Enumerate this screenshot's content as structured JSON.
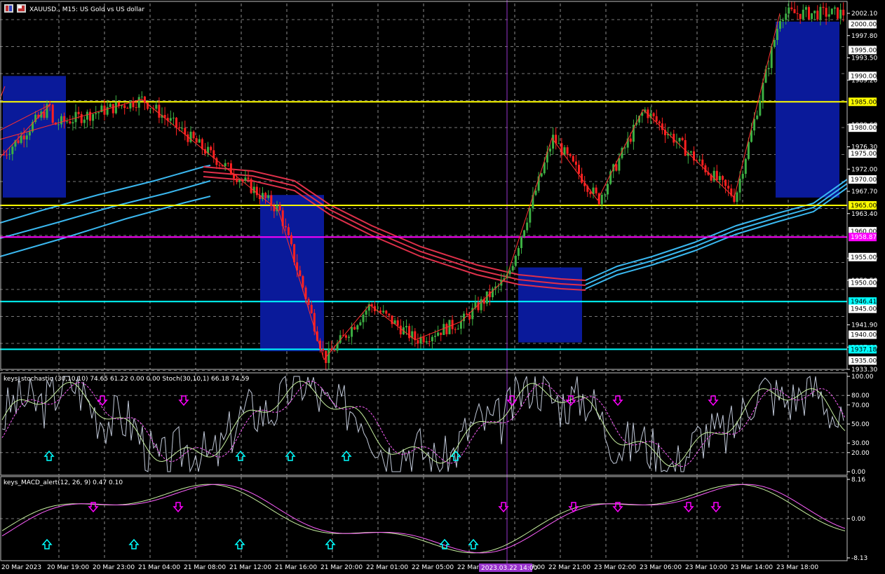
{
  "window": {
    "title": "XAUUSD., M15:  US Gold vs US dollar"
  },
  "colors": {
    "background": "#000000",
    "grid": "#c8c8c8",
    "bull": "#3cb043",
    "bear": "#ff2020",
    "zone": "#0a1a9a",
    "ema_red": "#e0304a",
    "ema_blue": "#3ab8f0",
    "level_yellow": "#ffff00",
    "level_magenta": "#ff00ff",
    "level_cyan": "#00ffff",
    "stoch_main": "#c8f0a0",
    "stoch_signal": "#ff60ff",
    "stoch_raw": "#c0c8d8",
    "vline": "#9933cc"
  },
  "indicators": {
    "stoch_header": "keys_stochastic (30,10,10) 74.65 61.22 0.00 0.00 Stoch(30,10,1) 66.18 74.59",
    "macd_header": "keys_MACD_alert(12, 26, 9) 0.47 0.10"
  },
  "price_axis": {
    "ticks": [
      "2002.10",
      "1997.80",
      "1993.50",
      "1989.20",
      "1980.60",
      "1976.30",
      "1972.00",
      "1967.70",
      "1963.40",
      "1954.80",
      "1950.50",
      "1941.90",
      "1937.60",
      "1933.30"
    ],
    "tags": [
      {
        "text": "2000.00",
        "style": "white"
      },
      {
        "text": "1995.00",
        "style": "white"
      },
      {
        "text": "1990.00",
        "style": "white"
      },
      {
        "text": "1985.00",
        "style": "yellow"
      },
      {
        "text": "1980.00",
        "style": "white"
      },
      {
        "text": "1975.00",
        "style": "white"
      },
      {
        "text": "1970.00",
        "style": "white"
      },
      {
        "text": "1965.00",
        "style": "yellow"
      },
      {
        "text": "1960.00",
        "style": "white"
      },
      {
        "text": "1958.87",
        "style": "magenta"
      },
      {
        "text": "1955.00",
        "style": "white"
      },
      {
        "text": "1950.00",
        "style": "white"
      },
      {
        "text": "1946.41",
        "style": "cyan"
      },
      {
        "text": "1945.00",
        "style": "white"
      },
      {
        "text": "1940.00",
        "style": "white"
      },
      {
        "text": "1937.18",
        "style": "cyan"
      },
      {
        "text": "1935.00",
        "style": "white"
      }
    ]
  },
  "stoch_axis": {
    "ticks": [
      "100.00",
      "80.00",
      "70.00",
      "50.00",
      "30.00",
      "20.00",
      "0.00"
    ]
  },
  "macd_axis": {
    "ticks": [
      "8.16",
      "0.00",
      "-8.13"
    ]
  },
  "time_axis": {
    "labels": [
      "20 Mar 2023",
      "20 Mar 19:00",
      "20 Mar 23:00",
      "21 Mar 04:00",
      "21 Mar 08:00",
      "21 Mar 12:00",
      "21 Mar 16:00",
      "21 Mar 20:00",
      "22 Mar 01:00",
      "22 Mar 05:00",
      "22 Mar 09:00",
      "22 Mar 17:00",
      "22 Mar 21:00",
      "23 Mar 02:00",
      "23 Mar 06:00",
      "23 Mar 10:00",
      "23 Mar 14:00",
      "23 Mar 18:00"
    ],
    "cursor_label": "2023.03.22 14:00"
  },
  "chart_data": {
    "type": "candlestick",
    "symbol": "XAUUSD.",
    "timeframe": "M15",
    "ylim": [
      1933.3,
      2004.0
    ],
    "horizontal_levels": [
      {
        "price": 1985.0,
        "color": "yellow"
      },
      {
        "price": 1965.0,
        "color": "yellow"
      },
      {
        "price": 1958.87,
        "color": "magenta"
      },
      {
        "price": 1946.41,
        "color": "cyan"
      },
      {
        "price": 1937.18,
        "color": "cyan"
      }
    ],
    "zigzag": [
      [
        "20 Mar 2023",
        1988.0
      ],
      [
        "20 Mar 16:00",
        1966.0
      ],
      [
        "20 Mar 19:00",
        1984.5
      ],
      [
        "21 Mar 01:00",
        1975.5
      ],
      [
        "21 Mar 04:00",
        1985.5
      ],
      [
        "21 Mar 16:00",
        1964.0
      ],
      [
        "21 Mar 20:00",
        1935.2
      ],
      [
        "22 Mar 01:00",
        1945.8
      ],
      [
        "22 Mar 05:00",
        1939.0
      ],
      [
        "22 Mar 09:00",
        1942.5
      ],
      [
        "22 Mar 17:00",
        1951.0
      ],
      [
        "22 Mar 21:00",
        1978.0
      ],
      [
        "23 Mar 02:00",
        1966.0
      ],
      [
        "23 Mar 06:00",
        1983.5
      ],
      [
        "23 Mar 10:00",
        1975.0
      ],
      [
        "23 Mar 14:00",
        1966.5
      ],
      [
        "23 Mar 18:00",
        2002.1
      ]
    ]
  }
}
